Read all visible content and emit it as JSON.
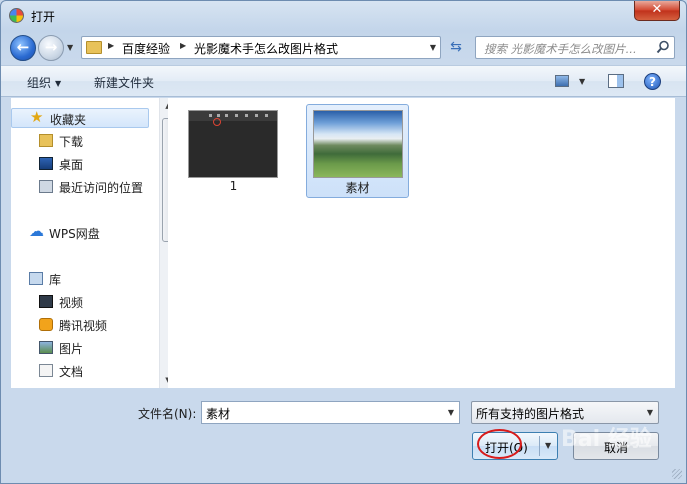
{
  "window": {
    "title": "打开",
    "close_glyph": "✕"
  },
  "address": {
    "crumbs": [
      "百度经验",
      "光影魔术手怎么改图片格式"
    ],
    "search_placeholder": "搜索 光影魔术手怎么改图片..."
  },
  "toolbar": {
    "organize": "组织",
    "new_folder": "新建文件夹",
    "help": "?"
  },
  "nav": {
    "items": [
      {
        "label": "收藏夹",
        "icon": "star-icon"
      },
      {
        "label": "下载",
        "icon": "download-folder-icon"
      },
      {
        "label": "桌面",
        "icon": "desktop-icon"
      },
      {
        "label": "最近访问的位置",
        "icon": "recent-places-icon"
      },
      {
        "label": "WPS网盘",
        "icon": "cloud-icon"
      },
      {
        "label": "库",
        "icon": "library-icon"
      },
      {
        "label": "视频",
        "icon": "video-icon"
      },
      {
        "label": "腾讯视频",
        "icon": "tencent-video-icon"
      },
      {
        "label": "图片",
        "icon": "pictures-icon"
      },
      {
        "label": "文档",
        "icon": "documents-icon"
      }
    ]
  },
  "files": [
    {
      "label": "1",
      "selected": false
    },
    {
      "label": "素材",
      "selected": true
    }
  ],
  "footer": {
    "filename_label": "文件名(N):",
    "filename_value": "素材",
    "filetype_value": "所有支持的图片格式",
    "open_label": "打开(O)",
    "cancel_label": "取消",
    "watermark": "Bai 经验"
  },
  "colors": {
    "accent": "#3c7fb1",
    "annotation_circle": "#d81b1b"
  }
}
